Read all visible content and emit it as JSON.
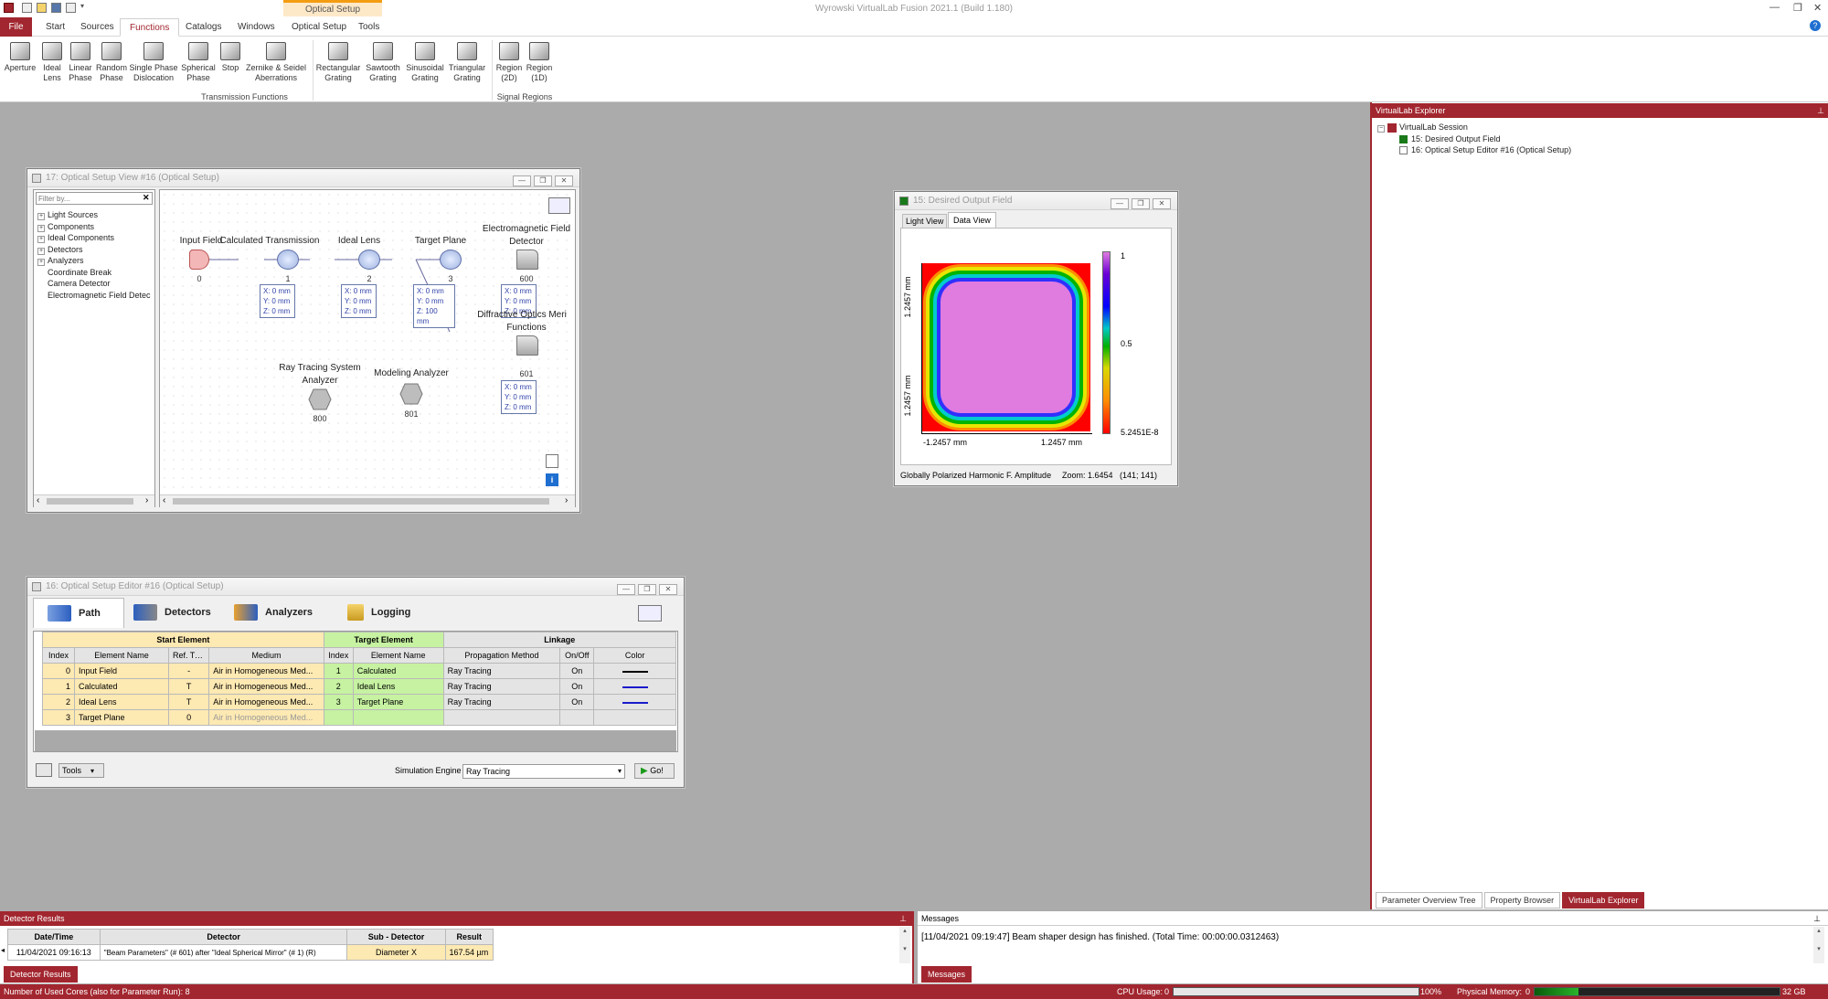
{
  "app": {
    "title": "Wyrowski VirtualLab Fusion 2021.1 (Build 1.180)",
    "context_tab": "Optical Setup",
    "win_min": "—",
    "win_max": "❐",
    "win_close": "✕",
    "help": "?"
  },
  "menu": {
    "file": "File",
    "items": [
      "Start",
      "Sources",
      "Functions",
      "Catalogs",
      "Windows",
      "Optical Setup",
      "Tools"
    ],
    "active": "Functions"
  },
  "ribbon": {
    "buttons": [
      {
        "line1": "Aperture",
        "line2": ""
      },
      {
        "line1": "Ideal",
        "line2": "Lens"
      },
      {
        "line1": "Linear",
        "line2": "Phase"
      },
      {
        "line1": "Random",
        "line2": "Phase"
      },
      {
        "line1": "Single Phase",
        "line2": "Dislocation"
      },
      {
        "line1": "Spherical",
        "line2": "Phase"
      },
      {
        "line1": "Stop",
        "line2": ""
      },
      {
        "line1": "Zernike & Seidel",
        "line2": "Aberrations"
      },
      {
        "line1": "Rectangular",
        "line2": "Grating"
      },
      {
        "line1": "Sawtooth",
        "line2": "Grating"
      },
      {
        "line1": "Sinusoidal",
        "line2": "Grating"
      },
      {
        "line1": "Triangular",
        "line2": "Grating"
      },
      {
        "line1": "Region",
        "line2": "(2D)"
      },
      {
        "line1": "Region",
        "line2": "(1D)"
      }
    ],
    "group1": "Transmission Functions",
    "group2": "Signal Regions"
  },
  "setup_view": {
    "title": "17: Optical Setup View #16 (Optical Setup)",
    "filter_placeholder": "Filter by...",
    "filter_clear": "✕",
    "tree": [
      {
        "label": "Light Sources",
        "expand": "+"
      },
      {
        "label": "Components",
        "expand": "+"
      },
      {
        "label": "Ideal Components",
        "expand": "+"
      },
      {
        "label": "Detectors",
        "expand": "+"
      },
      {
        "label": "Analyzers",
        "expand": "+"
      },
      {
        "label": "Coordinate Break",
        "expand": ""
      },
      {
        "label": "Camera Detector",
        "expand": ""
      },
      {
        "label": "Electromagnetic Field Detec",
        "expand": ""
      }
    ],
    "nodes": {
      "input_field": {
        "label": "Input Field",
        "num": "0"
      },
      "calc_trans": {
        "label": "Calculated Transmission",
        "num": "1",
        "c1": "X: 0 mm",
        "c2": "Y: 0 mm",
        "c3": "Z: 0 mm"
      },
      "ideal_lens": {
        "label": "Ideal Lens",
        "num": "2",
        "c1": "X: 0 mm",
        "c2": "Y: 0 mm",
        "c3": "Z: 0 mm"
      },
      "target_plane": {
        "label": "Target Plane",
        "num": "3",
        "c1": "X: 0 mm",
        "c2": "Y: 0 mm",
        "c3": "Z: 100 mm"
      },
      "em_detector": {
        "label1": "Electromagnetic Field",
        "label2": "Detector",
        "num": "600",
        "c1": "X: 0 mm",
        "c2": "Y: 0 mm",
        "c3": "Z: 0 mm"
      },
      "doe_merit": {
        "label1": "Diffractive Optics Meri",
        "label2": "Functions",
        "num": "601",
        "c1": "X: 0 mm",
        "c2": "Y: 0 mm",
        "c3": "Z: 0 mm"
      },
      "raytracing": {
        "label1": "Ray Tracing System",
        "label2": "Analyzer",
        "num": "800"
      },
      "modeling": {
        "label": "Modeling Analyzer",
        "num": "801"
      }
    },
    "scroll_left": "‹",
    "scroll_right": "›",
    "info": "i"
  },
  "output_field": {
    "title": "15: Desired Output Field",
    "tabs": [
      "Light View",
      "Data View"
    ],
    "ylabel_top": "1.2457 mm",
    "ylabel_bottom": "1.2457 mm",
    "xlabel_left": "-1.2457 mm",
    "xlabel_right": "1.2457 mm",
    "cbar_max": "1",
    "cbar_mid": "0.5",
    "cbar_min": "5.2451E-8",
    "status_mode": "Globally Polarized Harmonic F. Amplitude",
    "status_zoom": "Zoom: 1.6454",
    "status_size": "(141; 141)"
  },
  "editor": {
    "title": "16: Optical Setup Editor #16 (Optical Setup)",
    "tabs": [
      "Path",
      "Detectors",
      "Analyzers",
      "Logging"
    ],
    "group_start": "Start Element",
    "group_target": "Target Element",
    "group_link": "Linkage",
    "headers": [
      "Index",
      "Element Name",
      "Ref. Type",
      "Medium",
      "Index",
      "Element Name",
      "Propagation Method",
      "On/Off",
      "Color"
    ],
    "rows": [
      {
        "i": "0",
        "name": "Input Field",
        "ref": "-",
        "medium": "Air in Homogeneous Med...",
        "ti": "1",
        "tname": "Calculated",
        "prop": "Ray Tracing",
        "on": "On",
        "color": "#000000"
      },
      {
        "i": "1",
        "name": "Calculated",
        "ref": "T",
        "medium": "Air in Homogeneous Med...",
        "ti": "2",
        "tname": "Ideal Lens",
        "prop": "Ray Tracing",
        "on": "On",
        "color": "#1a1acc"
      },
      {
        "i": "2",
        "name": "Ideal Lens",
        "ref": "T",
        "medium": "Air in Homogeneous Med...",
        "ti": "3",
        "tname": "Target Plane",
        "prop": "Ray Tracing",
        "on": "On",
        "color": "#1a1acc"
      },
      {
        "i": "3",
        "name": "Target Plane",
        "ref": "0",
        "medium": "Air in Homogeneous Med...",
        "ti": "",
        "tname": "",
        "prop": "",
        "on": "",
        "color": ""
      }
    ],
    "tools_label": "Tools",
    "engine_label": "Simulation Engine",
    "engine_value": "Ray Tracing",
    "go_label": "Go!"
  },
  "explorer": {
    "title": "VirtualLab Explorer",
    "pin": "⊥",
    "root": "VirtualLab Session",
    "items": [
      "15: Desired Output Field",
      "16: Optical Setup Editor #16 (Optical Setup)"
    ],
    "tabs": [
      "Parameter Overview Tree",
      "Property Browser",
      "VirtualLab Explorer"
    ]
  },
  "detector_results": {
    "title": "Detector Results",
    "pin": "⊥",
    "headers": [
      "Date/Time",
      "Detector",
      "Sub - Detector",
      "Result"
    ],
    "row": {
      "date": "11/04/2021 09:16:13",
      "detector": "\"Beam Parameters\" (# 601) after \"Ideal Spherical Mirror\" (# 1) (R)",
      "sub": "Diameter X",
      "result": "167.54 µm"
    },
    "tab": "Detector Results"
  },
  "messages": {
    "title": "Messages",
    "pin": "⊥",
    "text": "[11/04/2021 09:19:47] Beam shaper design has finished. (Total Time: 00:00:00.0312463)",
    "tab": "Messages"
  },
  "statusbar": {
    "cores": "Number of Used Cores (also for Parameter Run): 8",
    "cpu_label": "CPU Usage:",
    "cpu_min": "0",
    "cpu_max": "100%",
    "cpu_fraction": 0,
    "mem_label": "Physical Memory:",
    "mem_min": "0",
    "mem_max": "32 GB",
    "mem_fraction": 0.18
  },
  "colors": {
    "brand": "#a2262f",
    "ribbon_accent": "#f39c12",
    "start_col": "#fde9b2",
    "target_col": "#c6f2a1"
  }
}
